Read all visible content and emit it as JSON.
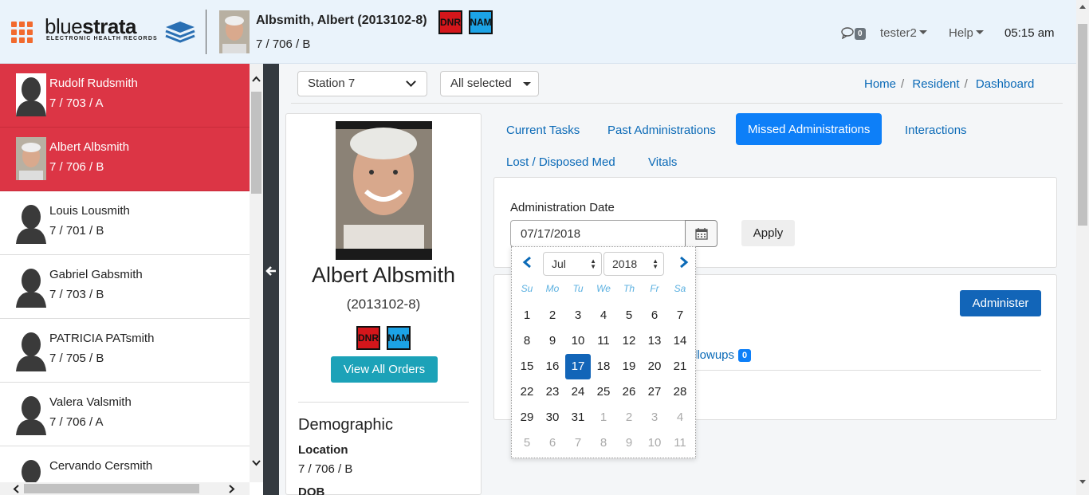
{
  "header": {
    "logo_text_thin": "blue",
    "logo_text_bold": "strata",
    "logo_sub": "ELECTRONIC HEALTH RECORDS",
    "patient_name": "Albsmith, Albert (2013102-8)",
    "patient_location": "7 / 706 / B",
    "badge_dnr": "DNR",
    "badge_nam": "NAM",
    "chat_count": "0",
    "user": "tester2",
    "help": "Help",
    "time": "05:15 am"
  },
  "sidebar": {
    "residents": [
      {
        "name": "Rudolf Rudsmith",
        "location": "7 / 703 / A",
        "selected": true,
        "photo": false
      },
      {
        "name": "Albert Albsmith",
        "location": "7 / 706 / B",
        "selected": true,
        "photo": true
      },
      {
        "name": "Louis Lousmith",
        "location": "7 / 701 / B",
        "selected": false,
        "photo": false
      },
      {
        "name": "Gabriel Gabsmith",
        "location": "7 / 703 / B",
        "selected": false,
        "photo": false
      },
      {
        "name": "PATRICIA PATsmith",
        "location": "7 / 705 / B",
        "selected": false,
        "photo": false
      },
      {
        "name": "Valera Valsmith",
        "location": "7 / 706 / A",
        "selected": false,
        "photo": false
      },
      {
        "name": "Cervando Cersmith",
        "location": "",
        "selected": false,
        "photo": false
      }
    ]
  },
  "filters": {
    "station": "Station 7",
    "selection": "All selected"
  },
  "breadcrumb": {
    "home": "Home",
    "resident": "Resident",
    "dashboard": "Dashboard"
  },
  "profile": {
    "name": "Albert Albsmith",
    "id": "(2013102-8)",
    "badge_dnr": "DNR",
    "badge_nam": "NAM",
    "view_orders": "View All Orders",
    "demographic": "Demographic",
    "location_label": "Location",
    "location": "7 / 706 / B",
    "dob_label": "DOB"
  },
  "tabs": {
    "current": "Current Tasks",
    "past": "Past Administrations",
    "missed": "Missed Administrations",
    "interactions": "Interactions",
    "lost": "Lost / Disposed Med",
    "vitals": "Vitals"
  },
  "admin": {
    "date_label": "Administration Date",
    "date_value": "07/17/2018",
    "apply": "Apply",
    "administer": "Administer",
    "followups_text": "llowups",
    "followups_count": "0"
  },
  "datepicker": {
    "month": "Jul",
    "year": "2018",
    "weekdays": [
      "Su",
      "Mo",
      "Tu",
      "We",
      "Th",
      "Fr",
      "Sa"
    ],
    "weeks": [
      [
        "1",
        "2",
        "3",
        "4",
        "5",
        "6",
        "7"
      ],
      [
        "8",
        "9",
        "10",
        "11",
        "12",
        "13",
        "14"
      ],
      [
        "15",
        "16",
        "17",
        "18",
        "19",
        "20",
        "21"
      ],
      [
        "22",
        "23",
        "24",
        "25",
        "26",
        "27",
        "28"
      ],
      [
        "29",
        "30",
        "31",
        "1",
        "2",
        "3",
        "4"
      ],
      [
        "5",
        "6",
        "7",
        "8",
        "9",
        "10",
        "11"
      ]
    ],
    "selected_day": "17",
    "accent_color": "#1265b8"
  },
  "colors": {
    "selected_resident": "#dc3545",
    "active_tab": "#0d7ff8",
    "link": "#0b6ab7",
    "view_orders_button": "#1ca2b8"
  }
}
